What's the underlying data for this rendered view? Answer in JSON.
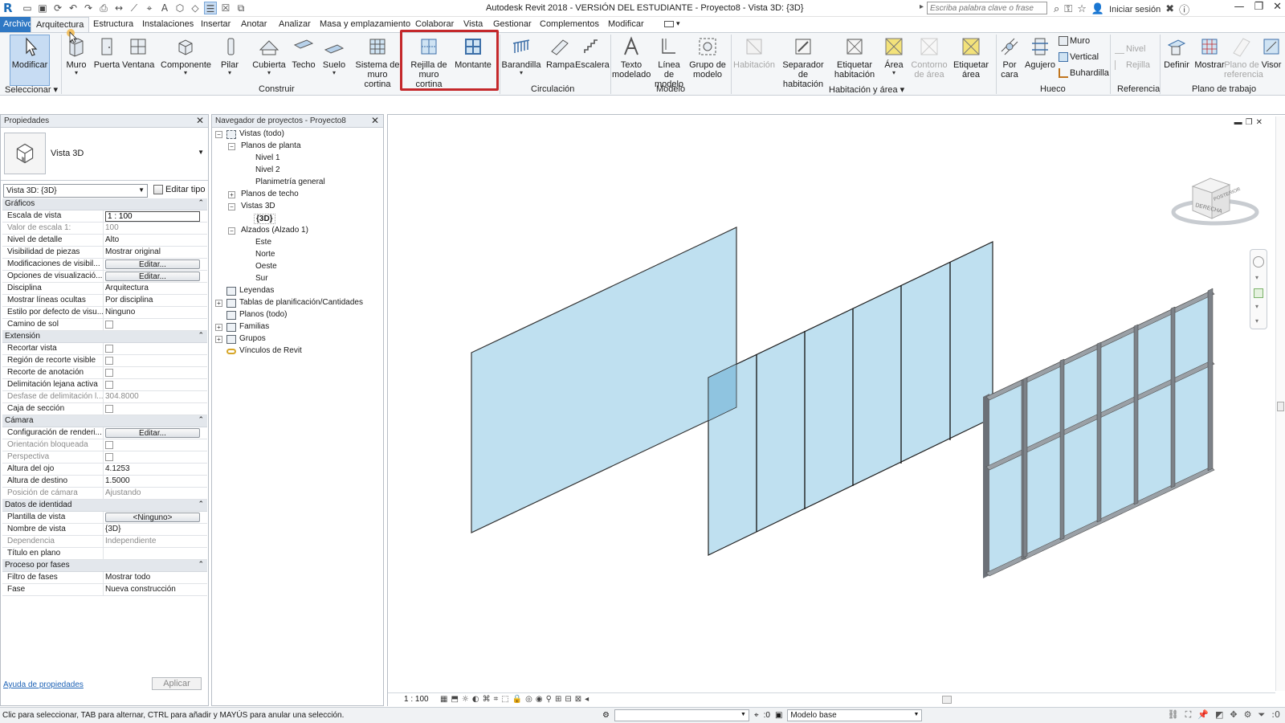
{
  "window": {
    "logo": "R",
    "title": "Autodesk Revit 2018 - VERSIÓN DEL ESTUDIANTE -     Proyecto8 - Vista 3D: {3D}",
    "search_placeholder": "Escriba palabra clave o frase",
    "signin": "Iniciar sesión"
  },
  "tabs": [
    "Archivo",
    "Arquitectura",
    "Estructura",
    "Instalaciones",
    "Insertar",
    "Anotar",
    "Analizar",
    "Masa y emplazamiento",
    "Colaborar",
    "Vista",
    "Gestionar",
    "Complementos",
    "Modificar"
  ],
  "ribbon": {
    "seleccionar": {
      "modificar": "Modificar",
      "label": "Seleccionar ▾"
    },
    "construir": {
      "label": "Construir",
      "muro": "Muro",
      "puerta": "Puerta",
      "ventana": "Ventana",
      "componente": "Componente",
      "pilar": "Pilar",
      "cubierta": "Cubierta",
      "techo": "Techo",
      "suelo": "Suelo",
      "sistema_1": "Sistema de",
      "sistema_2": "muro cortina",
      "rejilla_1": "Rejilla de",
      "rejilla_2": "muro cortina",
      "montante": "Montante"
    },
    "circulacion": {
      "label": "Circulación",
      "barandilla": "Barandilla",
      "rampa": "Rampa",
      "escalera": "Escalera"
    },
    "modelo": {
      "label": "Modelo",
      "texto_1": "Texto",
      "texto_2": "modelado",
      "linea_1": "Línea de",
      "linea_2": "modelo",
      "grupo_1": "Grupo de",
      "grupo_2": "modelo"
    },
    "habitacion": {
      "label": "Habitación y área ▾",
      "habitacion": "Habitación",
      "separador_1": "Separador",
      "separador_2": "de habitación",
      "etiquetar_1": "Etiquetar",
      "etiquetar_2": "habitación",
      "area": "Área",
      "contorno_1": "Contorno",
      "contorno_2": "de área",
      "etiquetar_area_1": "Etiquetar",
      "etiquetar_area_2": "área"
    },
    "hueco": {
      "label": "Hueco",
      "por_1": "Por",
      "por_2": "cara",
      "agujero": "Agujero",
      "muro": "Muro",
      "vertical": "Vertical",
      "buhardilla": "Buhardilla"
    },
    "referencia": {
      "label": "Referencia",
      "nivel": "Nivel",
      "rejilla": "Rejilla"
    },
    "plano_trabajo": {
      "label": "Plano de trabajo",
      "definir": "Definir",
      "mostrar": "Mostrar",
      "plano_1": "Plano de",
      "plano_2": "referencia",
      "visor": "Visor"
    }
  },
  "properties": {
    "header": "Propiedades",
    "type_name": "Vista 3D",
    "view_selector": "Vista 3D: {3D}",
    "edit_type": "Editar tipo",
    "sections": {
      "graficos": "Gráficos",
      "extension": "Extensión",
      "camara": "Cámara",
      "identidad": "Datos de identidad",
      "fases": "Proceso por fases"
    },
    "rows": {
      "escala_k": "Escala de vista",
      "escala_v": "1 : 100",
      "valor_k": "Valor de escala    1:",
      "valor_v": "100",
      "nivel_k": "Nivel de detalle",
      "nivel_v": "Alto",
      "visib_k": "Visibilidad de piezas",
      "visib_v": "Mostrar original",
      "modif_k": "Modificaciones de visibil...",
      "modif_v": "Editar...",
      "opciones_k": "Opciones de visualizació...",
      "opciones_v": "Editar...",
      "disc_k": "Disciplina",
      "disc_v": "Arquitectura",
      "ocultas_k": "Mostrar líneas ocultas",
      "ocultas_v": "Por disciplina",
      "estilo_k": "Estilo por defecto de visu...",
      "estilo_v": "Ninguno",
      "sol_k": "Camino de sol",
      "recortar_k": "Recortar vista",
      "region_k": "Región de recorte visible",
      "anotacion_k": "Recorte de anotación",
      "lejana_k": "Delimitación lejana activa",
      "desfase_k": "Desfase de delimitación l...",
      "desfase_v": "304.8000",
      "caja_k": "Caja de sección",
      "render_k": "Configuración de renderi...",
      "render_v": "Editar...",
      "orient_k": "Orientación bloqueada",
      "persp_k": "Perspectiva",
      "ojo_k": "Altura del ojo",
      "ojo_v": "4.1253",
      "destino_k": "Altura de destino",
      "destino_v": "1.5000",
      "pos_k": "Posición de cámara",
      "pos_v": "Ajustando",
      "plantilla_k": "Plantilla de vista",
      "plantilla_v": "<Ninguno>",
      "nombre_k": "Nombre de vista",
      "nombre_v": "{3D}",
      "dep_k": "Dependencia",
      "dep_v": "Independiente",
      "titulo_k": "Título en plano",
      "titulo_v": "",
      "filtro_k": "Filtro de fases",
      "filtro_v": "Mostrar todo",
      "fase_k": "Fase",
      "fase_v": "Nueva construcción"
    },
    "help": "Ayuda de propiedades",
    "apply": "Aplicar"
  },
  "browser": {
    "header": "Navegador de proyectos - Proyecto8",
    "vistas": "Vistas (todo)",
    "planos_planta": "Planos de planta",
    "nivel1": "Nivel 1",
    "nivel2": "Nivel 2",
    "planimetria": "Planimetría general",
    "planos_techo": "Planos de techo",
    "vistas3d": "Vistas 3D",
    "v3d": "{3D}",
    "alzados": "Alzados (Alzado 1)",
    "este": "Este",
    "norte": "Norte",
    "oeste": "Oeste",
    "sur": "Sur",
    "leyendas": "Leyendas",
    "tablas": "Tablas de planificación/Cantidades",
    "planos": "Planos (todo)",
    "familias": "Familias",
    "grupos": "Grupos",
    "vinculos": "Vínculos de Revit"
  },
  "viewport": {
    "scale": "1 : 100",
    "viewcube_front": "DERECHA",
    "viewcube_side": "POSTERIOR"
  },
  "status": {
    "text": "Clic para seleccionar, TAB para alternar, CTRL para añadir y MAYÚS para anular una selección.",
    "zero": ":0",
    "model": "Modelo base",
    "filter": ":0"
  },
  "colors": {
    "glass": "#bfe0f0",
    "mullion": "#7d8288",
    "highlight": "#c4282b",
    "accent": "#2f78c4"
  }
}
